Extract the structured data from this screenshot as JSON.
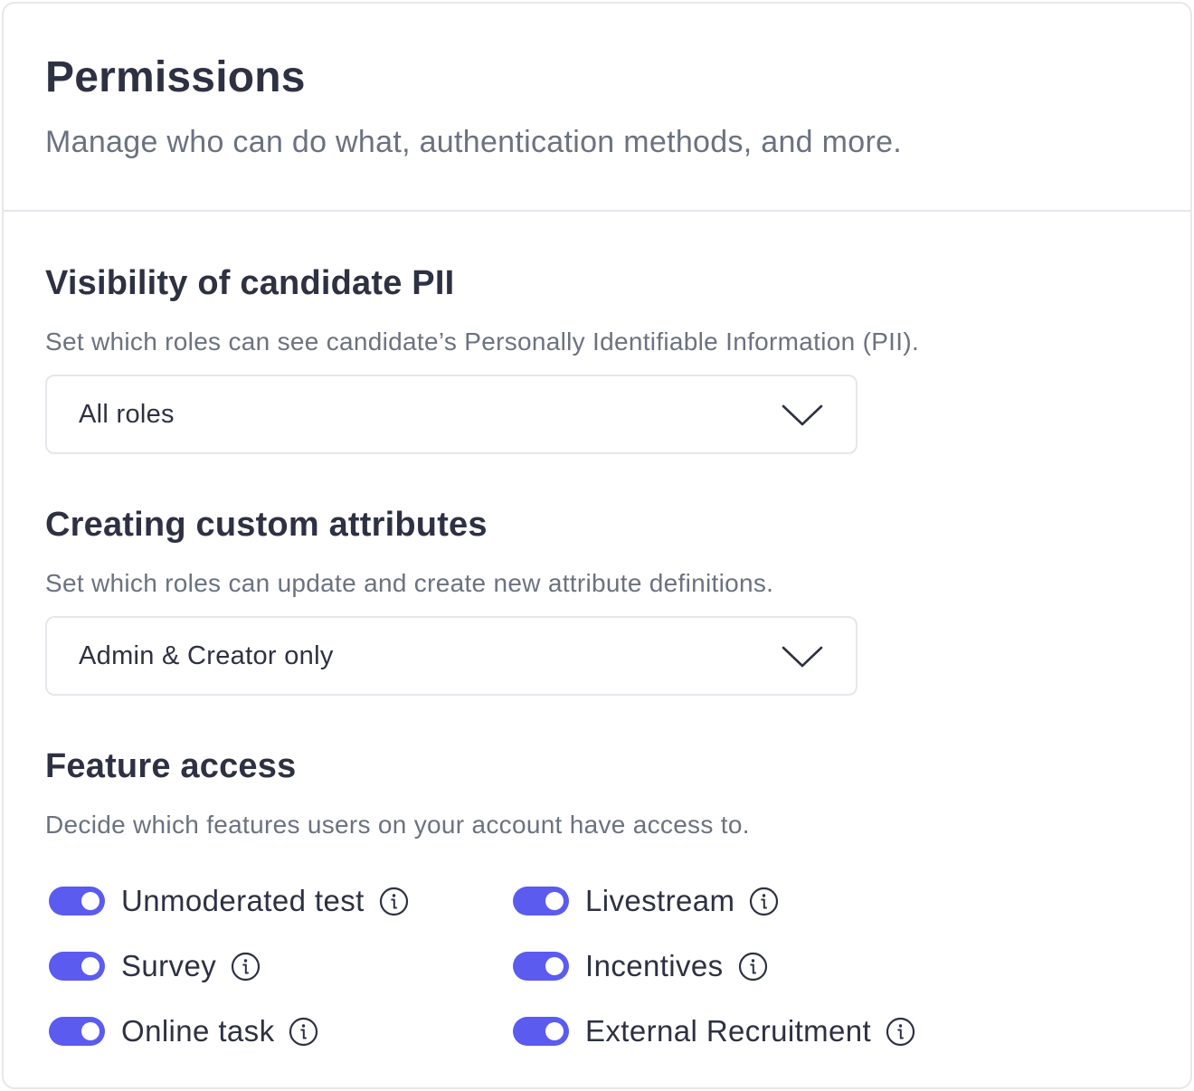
{
  "header": {
    "title": "Permissions",
    "subtitle": "Manage who can do what, authentication methods, and more."
  },
  "sections": [
    {
      "title": "Visibility of candidate PII",
      "description": "Set which roles can see candidate’s Personally Identifiable Information (PII).",
      "select_value": "All roles"
    },
    {
      "title": "Creating custom attributes",
      "description": "Set which roles can update and create new attribute definitions.",
      "select_value": "Admin & Creator only"
    },
    {
      "title": "Feature access",
      "description": "Decide which features users on your account have access to."
    }
  ],
  "features": [
    {
      "label": "Unmoderated test",
      "enabled": true,
      "icon": "info-icon"
    },
    {
      "label": "Livestream",
      "enabled": true,
      "icon": "info-icon"
    },
    {
      "label": "Survey",
      "enabled": true,
      "icon": "info-icon"
    },
    {
      "label": "Incentives",
      "enabled": true,
      "icon": "info-icon"
    },
    {
      "label": "Online task",
      "enabled": true,
      "icon": "info-icon"
    },
    {
      "label": "External Recruitment",
      "enabled": true,
      "icon": "info-icon"
    }
  ],
  "colors": {
    "toggle_on": "#5b5bf0",
    "heading": "#2d3142",
    "muted": "#6b7280",
    "border": "#e5e7eb"
  },
  "icons": {
    "dropdown": "chevron-down-icon",
    "info": "info-icon"
  }
}
